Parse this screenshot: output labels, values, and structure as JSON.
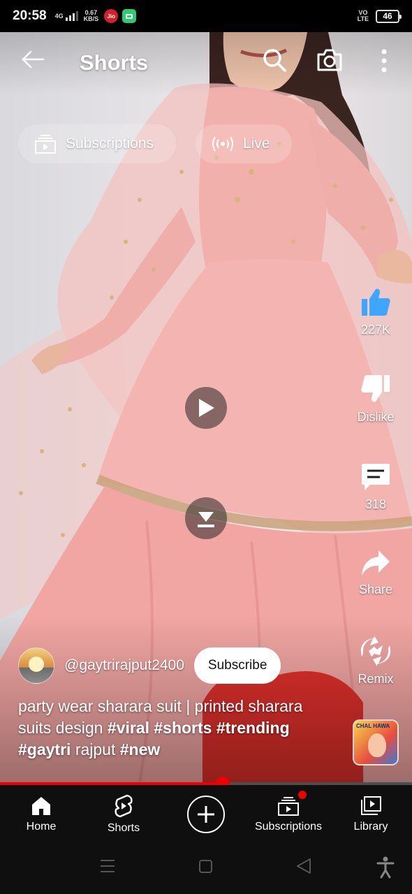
{
  "status_bar": {
    "time": "20:58",
    "network": "4G",
    "speed_value": "0.67",
    "speed_unit": "KB/S",
    "carrier_badge": "Jio",
    "volte_top": "VO",
    "volte_bottom": "LTE",
    "battery": "46"
  },
  "header": {
    "title": "Shorts"
  },
  "chips": {
    "subscriptions": "Subscriptions",
    "live": "Live"
  },
  "actions": {
    "like_count": "227K",
    "dislike_label": "Dislike",
    "comment_count": "318",
    "share_label": "Share",
    "remix_label": "Remix"
  },
  "channel": {
    "handle": "@gaytrirajput2400",
    "subscribe_label": "Subscribe"
  },
  "caption": {
    "text_1": "party wear sharara suit | printed sharara suits design ",
    "tag_1": "#viral",
    "tag_2": "#shorts",
    "tag_3": "#trending",
    "tag_4": "#gaytri",
    "text_2": " rajput ",
    "tag_5": "#new"
  },
  "sound_thumbnail_text": "CHAL HAWA",
  "progress": {
    "fraction": 0.54
  },
  "bottom_nav": {
    "home": "Home",
    "shorts": "Shorts",
    "subscriptions": "Subscriptions",
    "library": "Library"
  },
  "colors": {
    "like_active": "#3ea6ff",
    "progress_red": "#ee0000",
    "dress_pink": "#f2b3b0"
  },
  "icons": [
    "back-arrow-icon",
    "search-icon",
    "camera-icon",
    "more-vert-icon",
    "subscriptions-icon",
    "live-icon",
    "play-icon",
    "download-icon",
    "thumb-up-icon",
    "thumb-down-icon",
    "comment-icon",
    "share-icon",
    "remix-icon",
    "home-icon",
    "shorts-icon",
    "plus-icon",
    "library-icon"
  ]
}
